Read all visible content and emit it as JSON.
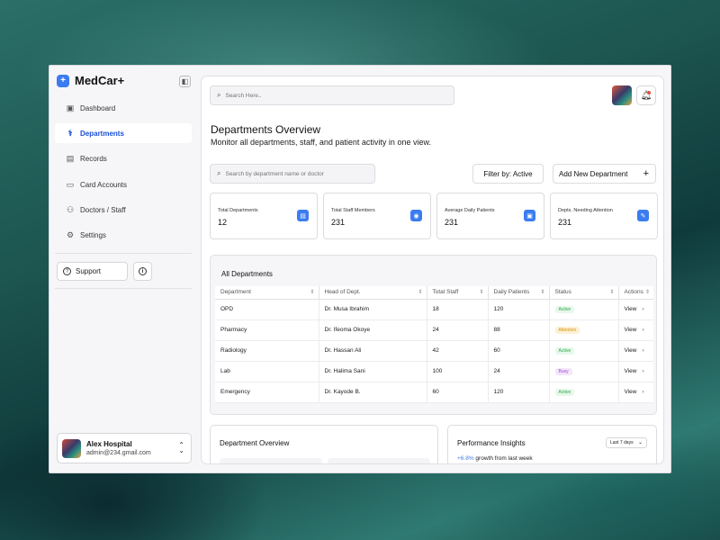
{
  "app": {
    "name": "MedCar+"
  },
  "sidebar": {
    "items": [
      {
        "label": "Dashboard",
        "icon": "dashboard-icon",
        "glyph": "▣",
        "active": false
      },
      {
        "label": "Departments",
        "icon": "departments-icon",
        "glyph": "⚕",
        "active": true
      },
      {
        "label": "Records",
        "icon": "records-icon",
        "glyph": "▤",
        "active": false
      },
      {
        "label": "Card Accounts",
        "icon": "card-icon",
        "glyph": "▭",
        "active": false
      },
      {
        "label": "Doctors / Staff",
        "icon": "staff-icon",
        "glyph": "⚇",
        "active": false
      },
      {
        "label": "Settings",
        "icon": "settings-icon",
        "glyph": "⚙",
        "active": false
      }
    ],
    "support_label": "Support",
    "user": {
      "name": "Alex Hospital",
      "email": "admin@234.gmail.com"
    }
  },
  "header": {
    "search_placeholder": "Search Here.."
  },
  "page": {
    "title": "Departments Overview",
    "subtitle": "Monitor all departments, staff, and patient activity in one view.",
    "dept_search_placeholder": "Search by department name or doctor",
    "filter_label": "Filter by: Active",
    "add_label": "Add New Department"
  },
  "stats": [
    {
      "label": "Total Departments",
      "value": "12",
      "icon": "document-icon",
      "glyph": "▤"
    },
    {
      "label": "Total Staff Members",
      "value": "231",
      "icon": "user-icon",
      "glyph": "◉"
    },
    {
      "label": "Average Daily Patients",
      "value": "231",
      "icon": "patient-card-icon",
      "glyph": "▣"
    },
    {
      "label": "Depts. Needing Attention",
      "value": "231",
      "icon": "pencil-icon",
      "glyph": "✎"
    }
  ],
  "table": {
    "title": "All Departments",
    "columns": [
      "Department",
      "Head of Dept.",
      "Total Staff",
      "Daily Patients",
      "Status",
      "Actions"
    ],
    "rows": [
      {
        "department": "OPD",
        "head": "Dr. Musa Ibrahim",
        "staff": "18",
        "patients": "120",
        "status": "Active",
        "action": "View"
      },
      {
        "department": "Pharmacy",
        "head": "Dr. Ifeoma Okoye",
        "staff": "24",
        "patients": "88",
        "status": "Attention",
        "action": "View"
      },
      {
        "department": "Radiology",
        "head": "Dr. Hassan Ali",
        "staff": "42",
        "patients": "60",
        "status": "Active",
        "action": "View"
      },
      {
        "department": "Lab",
        "head": "Dr. Halima Sani",
        "staff": "100",
        "patients": "24",
        "status": "Busy",
        "action": "View"
      },
      {
        "department": "Emergency",
        "head": "Dr. Kayode B.",
        "staff": "60",
        "patients": "120",
        "status": "Active",
        "action": "View"
      }
    ]
  },
  "status_colors": {
    "Active": {
      "bg": "#e6f8ea",
      "fg": "#2fa84f"
    },
    "Attention": {
      "bg": "#fdf0d6",
      "fg": "#d4940f"
    },
    "Busy": {
      "bg": "#f3e6fb",
      "fg": "#a04fd0"
    }
  },
  "dept_overview": {
    "title": "Department Overview"
  },
  "insights": {
    "title": "Performance Insights",
    "period": "Last 7 days",
    "growth_value": "+6.8%",
    "growth_text": " growth from last week"
  }
}
